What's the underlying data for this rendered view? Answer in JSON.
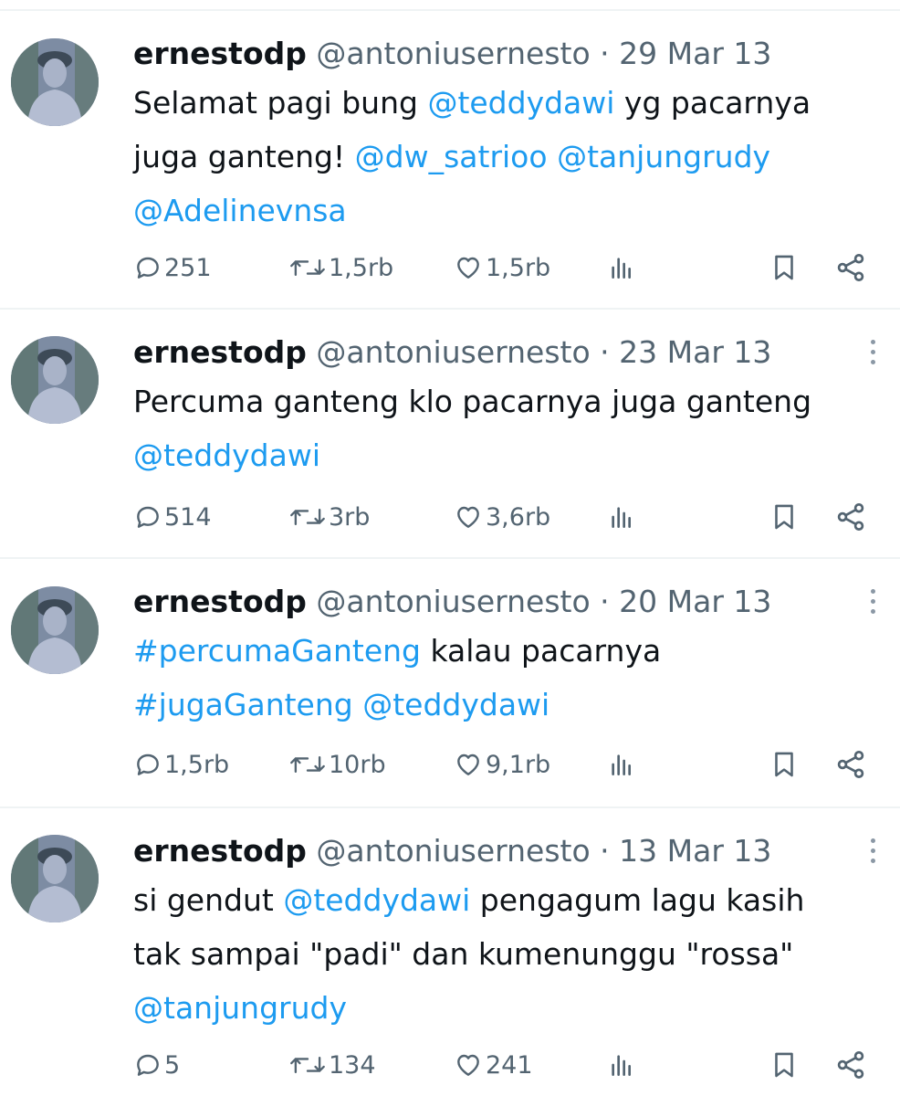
{
  "icons": {
    "reply": "reply-bubble-icon",
    "retweet": "retweet-icon",
    "like": "heart-icon",
    "views": "views-bar-icon",
    "bookmark": "bookmark-icon",
    "share": "share-icon",
    "more": "more-vertical-icon"
  },
  "colors": {
    "link": "#1d9bf0",
    "secondary": "#536471",
    "text": "#0f1419"
  },
  "tweets": [
    {
      "name": "ernestodp",
      "handle": "@antoniusernesto",
      "dot": "·",
      "date": "29 Mar 13",
      "lines": [
        [
          {
            "t": "Selamat pagi bung "
          },
          {
            "t": "@teddydawi",
            "link": true
          },
          {
            "t": " yg pacarnya"
          }
        ],
        [
          {
            "t": "juga ganteng! "
          },
          {
            "t": "@dw_satrioo",
            "link": true
          },
          {
            "t": " "
          },
          {
            "t": "@tanjungrudy",
            "link": true
          }
        ],
        [
          {
            "t": "@Adelinevnsa",
            "link": true
          }
        ]
      ],
      "replies": "251",
      "retweets": "1,5rb",
      "likes": "1,5rb"
    },
    {
      "name": "ernestodp",
      "handle": "@antoniusernesto",
      "dot": "·",
      "date": "23 Mar 13",
      "lines": [
        [
          {
            "t": "Percuma ganteng klo pacarnya juga ganteng"
          }
        ],
        [
          {
            "t": "@teddydawi",
            "link": true
          }
        ]
      ],
      "replies": "514",
      "retweets": "3rb",
      "likes": "3,6rb"
    },
    {
      "name": "ernestodp",
      "handle": "@antoniusernesto",
      "dot": "·",
      "date": "20 Mar 13",
      "lines": [
        [
          {
            "t": "#percumaGanteng",
            "link": true
          },
          {
            "t": " kalau pacarnya"
          }
        ],
        [
          {
            "t": "#jugaGanteng",
            "link": true
          },
          {
            "t": " "
          },
          {
            "t": "@teddydawi",
            "link": true
          }
        ]
      ],
      "replies": "1,5rb",
      "retweets": "10rb",
      "likes": "9,1rb"
    },
    {
      "name": "ernestodp",
      "handle": "@antoniusernesto",
      "dot": "·",
      "date": "13 Mar 13",
      "lines": [
        [
          {
            "t": "si gendut "
          },
          {
            "t": "@teddydawi",
            "link": true
          },
          {
            "t": " pengagum lagu kasih"
          }
        ],
        [
          {
            "t": "tak sampai \"padi\" dan kumenunggu \"rossa\""
          }
        ],
        [
          {
            "t": "@tanjungrudy",
            "link": true
          }
        ]
      ],
      "replies": "5",
      "retweets": "134",
      "likes": "241"
    }
  ]
}
